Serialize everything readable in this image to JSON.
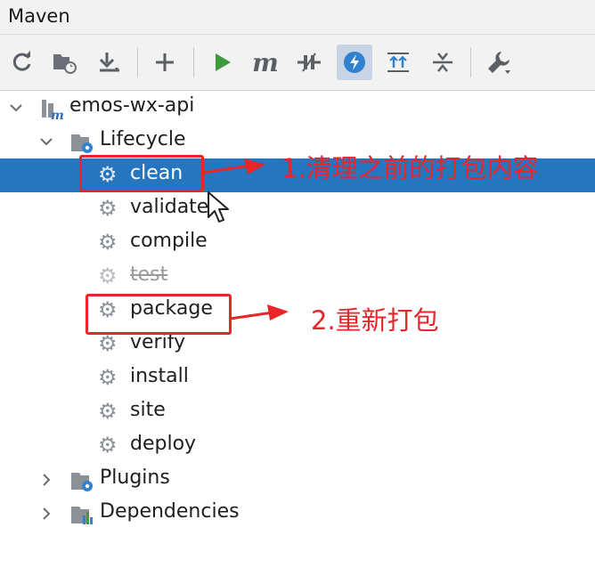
{
  "panel": {
    "title": "Maven"
  },
  "toolbar": {
    "buttons": [
      {
        "name": "reload-all-projects",
        "icon": "refresh-icon"
      },
      {
        "name": "generate-sources",
        "icon": "folder-refresh-icon"
      },
      {
        "name": "download-sources",
        "icon": "download-icon"
      },
      {
        "name": "add-maven-project",
        "icon": "plus-icon"
      },
      {
        "name": "run-maven-build",
        "icon": "run-icon"
      },
      {
        "name": "execute-maven-goal",
        "icon": "maven-m-icon"
      },
      {
        "name": "toggle-offline-mode",
        "icon": "offline-icon"
      },
      {
        "name": "skip-tests",
        "icon": "lightning-icon",
        "active": true
      },
      {
        "name": "show-dependencies",
        "icon": "dependencies-icon"
      },
      {
        "name": "collapse-all",
        "icon": "collapse-icon"
      },
      {
        "name": "maven-settings",
        "icon": "wrench-icon"
      }
    ]
  },
  "tree": {
    "project": "emos-wx-api",
    "lifecycle": {
      "label": "Lifecycle",
      "goals": [
        "clean",
        "validate",
        "compile",
        "test",
        "package",
        "verify",
        "install",
        "site",
        "deploy"
      ],
      "selected": "clean",
      "skipped": "test"
    },
    "plugins": "Plugins",
    "dependencies": "Dependencies"
  },
  "annotations": {
    "clean_note": "1.清理之前的打包内容",
    "package_note": "2.重新打包"
  },
  "colors": {
    "selection": "#2675bf",
    "annotation": "#e8262a",
    "run_green": "#3d9a3d",
    "gear_gray": "#8c9198"
  }
}
